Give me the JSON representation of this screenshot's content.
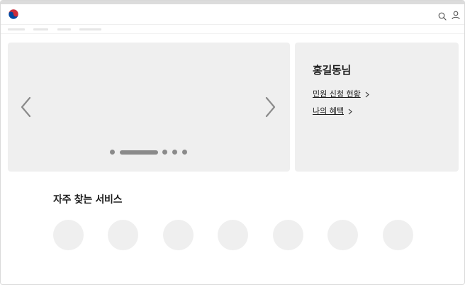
{
  "header": {
    "logo_icon": "government-emblem-icon",
    "search_icon": "search-icon",
    "user_icon": "user-icon",
    "accent_red": "#cd2e3a",
    "accent_blue": "#0047a0"
  },
  "nav": {
    "items": [
      "",
      "",
      "",
      ""
    ]
  },
  "carousel": {
    "prev_icon": "chevron-left-icon",
    "next_icon": "chevron-right-icon",
    "slide_count": 5,
    "active_slide": 2
  },
  "profile": {
    "name": "홍길동님",
    "links": [
      {
        "label": "민원 신청 현황",
        "icon": "chevron-right-icon"
      },
      {
        "label": "나의 혜택",
        "icon": "chevron-right-icon"
      }
    ]
  },
  "services": {
    "title": "자주 찾는 서비스",
    "items": [
      "",
      "",
      "",
      "",
      "",
      "",
      ""
    ]
  },
  "colors": {
    "panel_bg": "#efefef",
    "indicator": "#8a8a8a",
    "text": "#1e1e1e"
  }
}
